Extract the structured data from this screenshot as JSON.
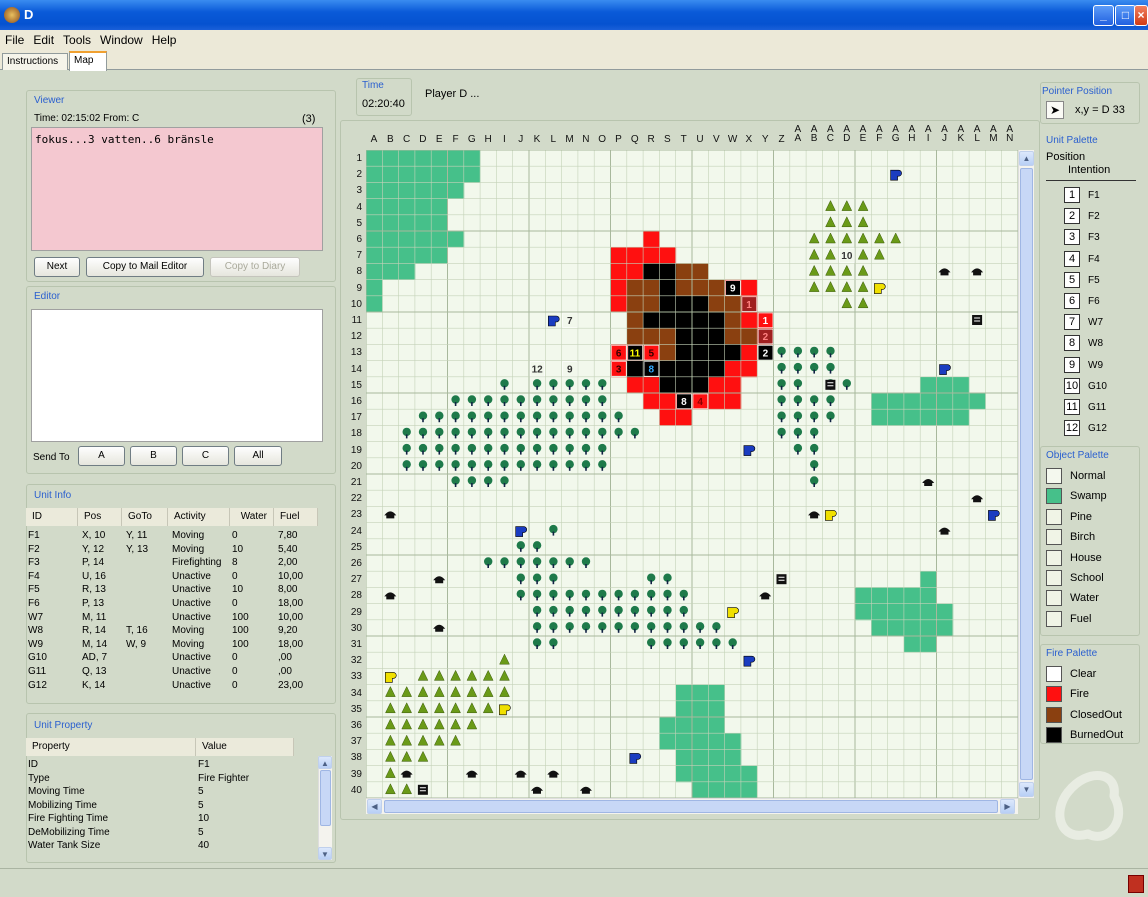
{
  "window": {
    "title": "D"
  },
  "menu": [
    "File",
    "Edit",
    "Tools",
    "Window",
    "Help"
  ],
  "tabs": [
    "Instructions",
    "Map"
  ],
  "viewer": {
    "title": "Viewer",
    "info": "Time: 02:15:02  From: C",
    "count": "(3)",
    "message": "fokus...3 vatten..6 bränsle",
    "buttons": {
      "next": "Next",
      "copy_mail": "Copy to Mail Editor",
      "copy_diary": "Copy to Diary"
    }
  },
  "editor": {
    "title": "Editor",
    "send_to": "Send To",
    "send_buttons": [
      "A",
      "B",
      "C",
      "All"
    ]
  },
  "unit_info": {
    "title": "Unit Info",
    "columns": [
      "ID",
      "Pos",
      "GoTo",
      "Activity",
      "Water",
      "Fuel"
    ],
    "rows": [
      [
        "F1",
        "X, 10",
        "Y, 11",
        "Moving",
        "0",
        "7,80"
      ],
      [
        "F2",
        "Y, 12",
        "Y, 13",
        "Moving",
        "10",
        "5,40"
      ],
      [
        "F3",
        "P, 14",
        "",
        "Firefighting",
        "8",
        "2,00"
      ],
      [
        "F4",
        "U, 16",
        "",
        "Unactive",
        "0",
        "10,00"
      ],
      [
        "F5",
        "R, 13",
        "",
        "Unactive",
        "10",
        "8,00"
      ],
      [
        "F6",
        "P, 13",
        "",
        "Unactive",
        "0",
        "18,00"
      ],
      [
        "W7",
        "M, 11",
        "",
        "Unactive",
        "100",
        "10,00"
      ],
      [
        "W8",
        "R, 14",
        "T, 16",
        "Moving",
        "100",
        "9,20"
      ],
      [
        "W9",
        "M, 14",
        "W, 9",
        "Moving",
        "100",
        "18,00"
      ],
      [
        "G10",
        "AD, 7",
        "",
        "Unactive",
        "0",
        ",00"
      ],
      [
        "G11",
        "Q, 13",
        "",
        "Unactive",
        "0",
        ",00"
      ],
      [
        "G12",
        "K, 14",
        "",
        "Unactive",
        "0",
        "23,00"
      ]
    ]
  },
  "unit_property": {
    "title": "Unit Property",
    "columns": [
      "Property",
      "Value"
    ],
    "rows": [
      [
        "ID",
        "F1"
      ],
      [
        "Type",
        "Fire Fighter"
      ],
      [
        "Moving Time",
        "5"
      ],
      [
        "Mobilizing Time",
        "5"
      ],
      [
        "Fire Fighting Time",
        "10"
      ],
      [
        "DeMobilizing Time",
        "5"
      ],
      [
        "Water Tank Size",
        "40"
      ]
    ]
  },
  "time": {
    "label": "Time",
    "value": "02:20:40",
    "player": "Player D ..."
  },
  "pointer": {
    "title": "Pointer Position",
    "text": "x,y =  D 33"
  },
  "unit_palette": {
    "title": "Unit Palette",
    "header1": "Position",
    "header2": "Intention",
    "units": [
      {
        "id": "F1",
        "num": "1"
      },
      {
        "id": "F2",
        "num": "2"
      },
      {
        "id": "F3",
        "num": "3"
      },
      {
        "id": "F4",
        "num": "4"
      },
      {
        "id": "F5",
        "num": "5"
      },
      {
        "id": "F6",
        "num": "6"
      },
      {
        "id": "W7",
        "num": "7"
      },
      {
        "id": "W8",
        "num": "8"
      },
      {
        "id": "W9",
        "num": "9"
      },
      {
        "id": "G10",
        "num": "10"
      },
      {
        "id": "G11",
        "num": "11"
      },
      {
        "id": "G12",
        "num": "12"
      }
    ]
  },
  "object_palette": {
    "title": "Object Palette",
    "items": [
      {
        "label": "Normal",
        "color": "#f4f8ee"
      },
      {
        "label": "Swamp",
        "color": "#46c08a"
      },
      {
        "label": "Pine",
        "color": "#f0f4e6"
      },
      {
        "label": "Birch",
        "color": "#f0f4e6"
      },
      {
        "label": "House",
        "color": "#f0f4e6"
      },
      {
        "label": "School",
        "color": "#f0f4e6"
      },
      {
        "label": "Water",
        "color": "#f0f4e6"
      },
      {
        "label": "Fuel",
        "color": "#f0f4e6"
      }
    ]
  },
  "fire_palette": {
    "title": "Fire Palette",
    "items": [
      {
        "label": "Clear",
        "color": "#ffffff"
      },
      {
        "label": "Fire",
        "color": "#ff1010"
      },
      {
        "label": "ClosedOut",
        "color": "#8a4010"
      },
      {
        "label": "BurnedOut",
        "color": "#000000"
      }
    ]
  },
  "map": {
    "cols": [
      "A",
      "B",
      "C",
      "D",
      "E",
      "F",
      "G",
      "H",
      "I",
      "J",
      "K",
      "L",
      "M",
      "N",
      "O",
      "P",
      "Q",
      "R",
      "S",
      "T",
      "U",
      "V",
      "W",
      "X",
      "Y",
      "Z",
      "AA",
      "AB",
      "AC",
      "AD",
      "AE",
      "AF",
      "AG",
      "AH",
      "AI",
      "AJ",
      "AK",
      "AL",
      "AM",
      "AN"
    ],
    "colors": {
      "swamp": "#46c08a",
      "fire": "#ff1010",
      "closed": "#8a4010",
      "burned": "#000000",
      "grid": "#c4d2b8",
      "bg": "#f2f8ec",
      "pine": "#6a9a18",
      "birch": "#1e7a4a"
    },
    "unit_labels": [
      {
        "c": 22,
        "r": 9,
        "t": "9",
        "bg": "#000",
        "fg": "#fff"
      },
      {
        "c": 23,
        "r": 10,
        "t": "1",
        "bg": "#a02020",
        "fg": "#ff8080"
      },
      {
        "c": 24,
        "r": 11,
        "t": "1",
        "bg": "#ff1010",
        "fg": "#fff"
      },
      {
        "c": 24,
        "r": 12,
        "t": "2",
        "bg": "#a02020",
        "fg": "#ff8080"
      },
      {
        "c": 24,
        "r": 13,
        "t": "2",
        "bg": "#000",
        "fg": "#fff"
      },
      {
        "c": 15,
        "r": 13,
        "t": "6",
        "bg": "#ff1010",
        "fg": "#300"
      },
      {
        "c": 16,
        "r": 13,
        "t": "11",
        "bg": "#000",
        "fg": "#ff0"
      },
      {
        "c": 17,
        "r": 13,
        "t": "5",
        "bg": "#ff1010",
        "fg": "#300"
      },
      {
        "c": 15,
        "r": 14,
        "t": "3",
        "bg": "#ff1010",
        "fg": "#300"
      },
      {
        "c": 17,
        "r": 14,
        "t": "8",
        "bg": "#000",
        "fg": "#3af"
      },
      {
        "c": 19,
        "r": 16,
        "t": "8",
        "bg": "#000",
        "fg": "#fff"
      },
      {
        "c": 20,
        "r": 16,
        "t": "4",
        "bg": "#ff1010",
        "fg": "#800"
      },
      {
        "c": 10,
        "r": 14,
        "t": "12",
        "bg": "#f2f8ec",
        "fg": "#333"
      },
      {
        "c": 12,
        "r": 14,
        "t": "9",
        "bg": "#f2f8ec",
        "fg": "#333"
      },
      {
        "c": 12,
        "r": 11,
        "t": "7",
        "bg": "#f2f8ec",
        "fg": "#333"
      },
      {
        "c": 29,
        "r": 7,
        "t": "10",
        "bg": "#f2f8ec",
        "fg": "#333"
      }
    ]
  }
}
